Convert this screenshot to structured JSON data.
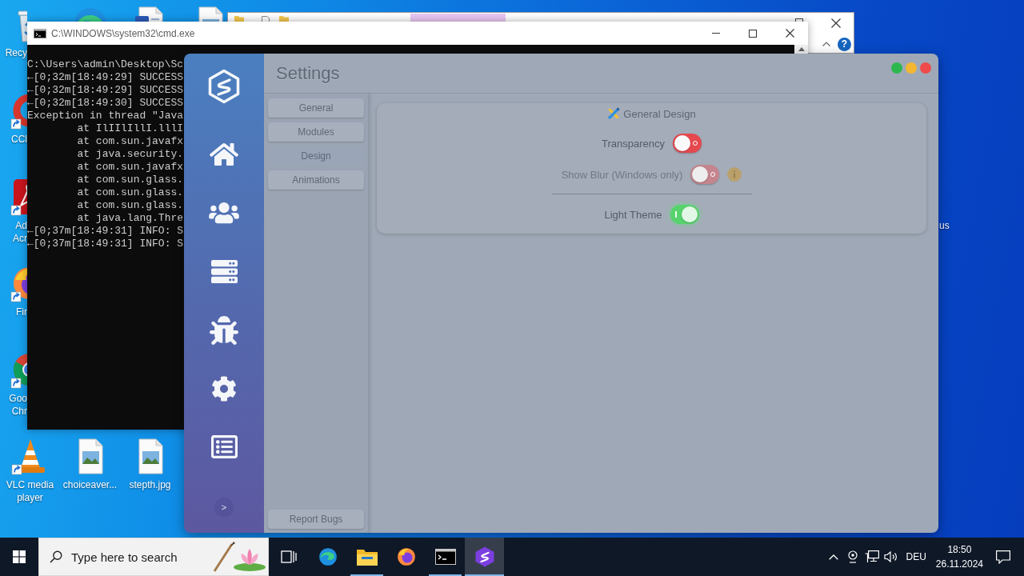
{
  "desktop": {
    "icons": [
      {
        "kind": "recycle-bin",
        "shortcut": false,
        "label_lines": [
          "Recy"
        ]
      },
      {
        "kind": "cleaner",
        "shortcut": true,
        "label_lines": [
          "CCl"
        ]
      },
      {
        "kind": "pdf-reader",
        "shortcut": true,
        "label_lines": [
          "Ad",
          "Acr"
        ]
      },
      {
        "kind": "firefox",
        "shortcut": true,
        "label_lines": [
          "Fir"
        ]
      },
      {
        "kind": "chrome",
        "shortcut": true,
        "label_lines": [
          "Goo",
          "Chr"
        ]
      },
      {
        "kind": "vlc",
        "shortcut": true,
        "label_lines": [
          "VLC media",
          "player"
        ]
      },
      {
        "kind": "image-file",
        "shortcut": false,
        "label_lines": [
          "choiceaver..."
        ]
      },
      {
        "kind": "image-file",
        "shortcut": false,
        "label_lines": [
          "stepth.jpg"
        ]
      },
      {
        "kind": "edge"
      },
      {
        "kind": "word-doc"
      },
      {
        "kind": "image-file"
      }
    ],
    "partial_label": "us"
  },
  "explorer_window": {
    "help_button": "?"
  },
  "cmd_window": {
    "title": "C:\\WINDOWS\\system32\\cmd.exe",
    "lines": [
      "C:\\Users\\admin\\Desktop\\Sc",
      "←[0;32m[18:49:29] SUCCESS",
      "←[0;32m[18:49:29] SUCCESS",
      "←[0;32m[18:49:30] SUCCESS",
      "Exception in thread \"Java",
      "\tat IlIIlIllI.lllI",
      "\tat com.sun.javafx",
      "\tat java.security.",
      "\tat com.sun.javafx",
      "\tat com.sun.glass.",
      "\tat com.sun.glass.",
      "\tat com.sun.glass.",
      "\tat java.lang.Thre",
      "←[0;37m[18:49:31] INFO: S",
      "←[0;37m[18:49:31] INFO: S"
    ]
  },
  "settings_window": {
    "title": "Settings",
    "window_controls": [
      {
        "color": "#2db84f"
      },
      {
        "color": "#f4b731"
      },
      {
        "color": "#ef4b4b"
      }
    ],
    "sidebar": {
      "items": [
        {
          "kind": "home"
        },
        {
          "kind": "users"
        },
        {
          "kind": "servers"
        },
        {
          "kind": "bug"
        },
        {
          "kind": "gear"
        },
        {
          "kind": "list"
        }
      ],
      "expand_button": ">"
    },
    "sections": [
      {
        "label": "General",
        "selected": false
      },
      {
        "label": "Modules",
        "selected": false
      },
      {
        "label": "Design",
        "selected": true
      },
      {
        "label": "Animations",
        "selected": false
      }
    ],
    "report_button": "Report Bugs",
    "panel": {
      "title": "General Design",
      "rows": [
        {
          "kind": "toggle",
          "label": "Transparency",
          "on": false,
          "disabled": false,
          "info": false
        },
        {
          "kind": "toggle",
          "label": "Show Blur (Windows only)",
          "on": false,
          "disabled": true,
          "info": true
        },
        {
          "kind": "divider"
        },
        {
          "kind": "toggle",
          "label": "Light Theme",
          "on": true,
          "disabled": false,
          "info": false
        }
      ]
    }
  },
  "taskbar": {
    "search": {
      "placeholder": "Type here to search"
    },
    "apps": [
      {
        "kind": "task-view",
        "running": false,
        "selected": false
      },
      {
        "kind": "edge",
        "running": false,
        "selected": false
      },
      {
        "kind": "explorer",
        "running": true,
        "selected": false
      },
      {
        "kind": "firefox",
        "running": false,
        "selected": false
      },
      {
        "kind": "terminal",
        "running": true,
        "selected": false
      },
      {
        "kind": "settings-app",
        "running": true,
        "selected": true
      }
    ],
    "tray": {
      "language": "DEU",
      "time": "18:50",
      "date": "26.11.2024"
    }
  }
}
